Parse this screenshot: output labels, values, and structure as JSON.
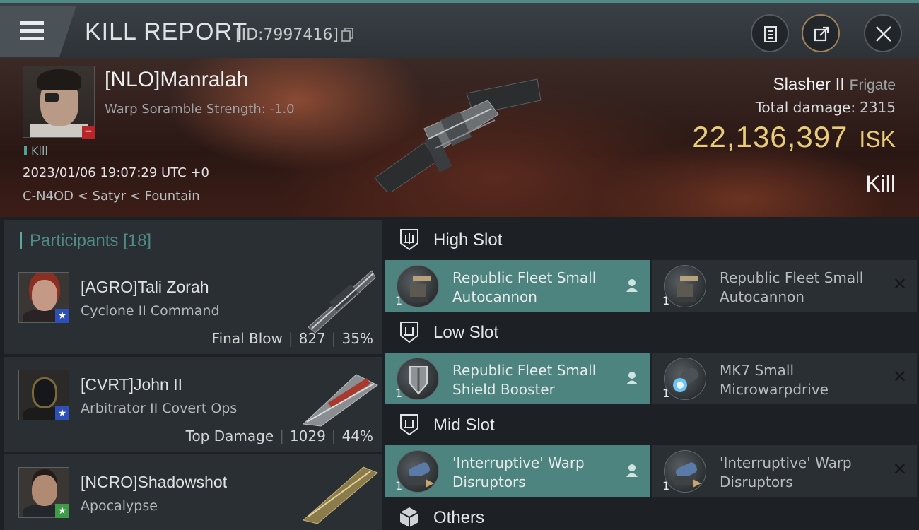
{
  "header": {
    "title": "KILL REPORT",
    "report_id": "[ID:7997416]"
  },
  "victim": {
    "name": "[NLO]Manralah",
    "subtitle": "Warp Soramble Strength: -1.0",
    "tag": "Kill",
    "time": "2023/01/06 19:07:29 UTC +0",
    "location": "C-N4OD < Satyr < Fountain",
    "ship": "Slasher II",
    "ship_class": "Frigate",
    "total_damage_label": "Total damage:",
    "total_damage": "2315",
    "isk_amount": "22,136,397",
    "isk_unit": "ISK",
    "result": "Kill"
  },
  "participants": {
    "label": "Participants",
    "count": "[18]",
    "rows": [
      {
        "name": "[AGRO]Tali Zorah",
        "ship": "Cyclone II Command",
        "stat_label": "Final Blow",
        "damage": "827",
        "percent": "35%"
      },
      {
        "name": "[CVRT]John II",
        "ship": "Arbitrator II Covert Ops",
        "stat_label": "Top Damage",
        "damage": "1029",
        "percent": "44%"
      },
      {
        "name": "[NCRO]Shadowshot",
        "ship": "Apocalypse"
      }
    ]
  },
  "slots": {
    "high": {
      "label": "High Slot",
      "modules": [
        {
          "name_line1": "Republic Fleet Small",
          "name_line2": "Autocannon",
          "qty": "1",
          "state": "dropped"
        },
        {
          "name_line1": "Republic Fleet Small",
          "name_line2": "Autocannon",
          "qty": "1",
          "state": "destroyed"
        }
      ]
    },
    "low": {
      "label": "Low Slot",
      "modules": [
        {
          "name_line1": "Republic Fleet Small",
          "name_line2": "Shield Booster",
          "qty": "1",
          "state": "dropped"
        },
        {
          "name_line1": "MK7 Small",
          "name_line2": "Microwarpdrive",
          "qty": "1",
          "state": "destroyed"
        }
      ]
    },
    "mid": {
      "label": "Mid Slot",
      "modules": [
        {
          "name_line1": "'Interruptive' Warp",
          "name_line2": "Disruptors",
          "qty": "1",
          "state": "dropped"
        },
        {
          "name_line1": "'Interruptive' Warp",
          "name_line2": "Disruptors",
          "qty": "1",
          "state": "destroyed"
        }
      ]
    },
    "others": {
      "label": "Others"
    }
  },
  "colors": {
    "accent_teal": "#4d8480",
    "isk_gold": "#e9cc7a",
    "badge_red": "#b8262a",
    "star_blue": "#2c4fb8",
    "star_green": "#3f9b4a"
  }
}
